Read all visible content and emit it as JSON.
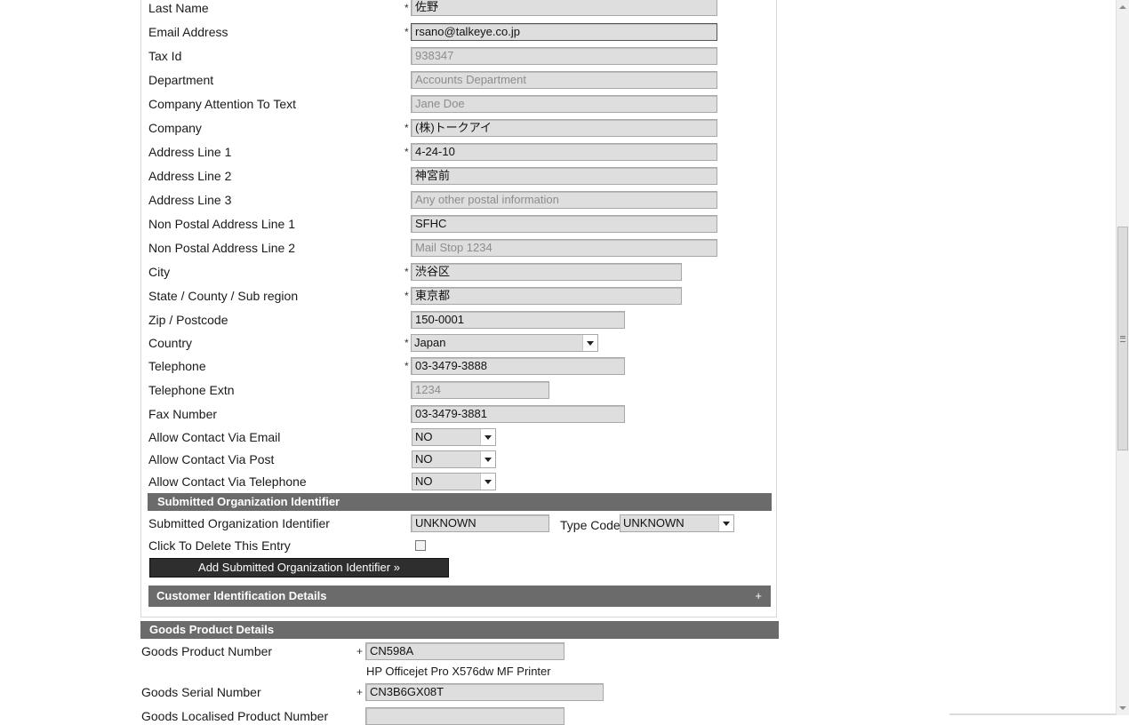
{
  "contact_fields": [
    {
      "label": "Last Name",
      "value": "佐野",
      "required": true
    },
    {
      "label": "Email Address",
      "value": "rsano@talkeye.co.jp",
      "required": true
    },
    {
      "label": "Tax Id",
      "value": "938347",
      "placeholder": true
    },
    {
      "label": "Department",
      "value": "Accounts Department",
      "placeholder": true
    },
    {
      "label": "Company Attention To Text",
      "value": "Jane Doe",
      "placeholder": true
    },
    {
      "label": "Company",
      "value": "(株)トークアイ",
      "required": true
    },
    {
      "label": "Address Line 1",
      "value": "4-24-10",
      "required": true
    },
    {
      "label": "Address Line 2",
      "value": "神宮前"
    },
    {
      "label": "Address Line 3",
      "value": "Any other postal information",
      "placeholder": true
    },
    {
      "label": "Non Postal Address Line 1",
      "value": "SFHC"
    },
    {
      "label": "Non Postal Address Line 2",
      "value": "Mail Stop 1234",
      "placeholder": true
    },
    {
      "label": "City",
      "value": "渋谷区",
      "required": true
    },
    {
      "label": "State / County / Sub region",
      "value": "東京都",
      "required": true
    },
    {
      "label": "Zip / Postcode",
      "value": "150-0001"
    },
    {
      "label": "Country",
      "value": "Japan",
      "required": true,
      "type": "select"
    },
    {
      "label": "Telephone",
      "value": "03-3479-3888",
      "required": true
    },
    {
      "label": "Telephone Extn",
      "value": "1234",
      "placeholder": true
    },
    {
      "label": "Fax Number",
      "value": "03-3479-3881"
    },
    {
      "label": "Allow Contact Via Email",
      "value": "NO",
      "type": "select"
    },
    {
      "label": "Allow Contact Via Post",
      "value": "NO",
      "type": "select"
    },
    {
      "label": "Allow Contact Via Telephone",
      "value": "NO",
      "type": "select"
    }
  ],
  "required_marker": "*",
  "submitted_org": {
    "section_title": "Submitted Organization Identifier",
    "identifier_label": "Submitted Organization Identifier",
    "identifier_value": "UNKNOWN",
    "type_code_label": "Type Code",
    "type_code_value": "UNKNOWN",
    "delete_label": "Click To Delete This Entry",
    "delete_checked": false,
    "add_button_label": "Add Submitted Organization Identifier »"
  },
  "customer_identification": {
    "section_title": "Customer Identification Details",
    "expand_symbol": "+"
  },
  "goods": {
    "section_title": "Goods Product Details",
    "product_number_label": "Goods Product Number",
    "product_number_value": "CN598A",
    "product_name": "HP Officejet Pro X576dw MF Printer",
    "serial_number_label": "Goods Serial Number",
    "serial_number_value": "CN3B6GX08T",
    "next_label_partial": "Goods Localised Product Number",
    "required_marker": "+"
  },
  "colors": {
    "section_bar": "#6b6b6b",
    "dark_button": "#2e2e2e",
    "field_bg": "#dedede"
  }
}
